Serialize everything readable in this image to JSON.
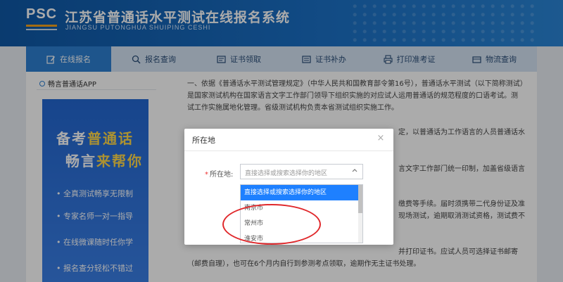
{
  "header": {
    "logo_text": "PSC",
    "title": "江苏省普通话水平测试在线报名系统",
    "subtitle": "JIANGSU PUTONGHUA SHUIPING CESHI"
  },
  "nav": {
    "items": [
      {
        "label": "在线报名",
        "icon": "edit-icon",
        "active": true
      },
      {
        "label": "报名查询",
        "icon": "search-icon",
        "active": false
      },
      {
        "label": "证书领取",
        "icon": "certificate-icon",
        "active": false
      },
      {
        "label": "证书补办",
        "icon": "certificate-reissue-icon",
        "active": false
      },
      {
        "label": "打印准考证",
        "icon": "printer-icon",
        "active": false
      },
      {
        "label": "物流查询",
        "icon": "truck-icon",
        "active": false
      }
    ]
  },
  "sidebar": {
    "title": "畅言普通话APP",
    "promo": {
      "line1_a": "备考",
      "line1_b": "普通话",
      "line2_a": "畅言",
      "line2_b": "来帮你",
      "items": [
        "全真测试畅享无限制",
        "专家名师一对一指导",
        "在线微课随时任你学",
        "报名查分轻松不错过"
      ]
    }
  },
  "article": {
    "p1": "一、依据《普通话水平测试管理规定》（中华人民共和国教育部令第16号），普通话水平测试（以下简称测试）是国家测试机构在国家语言文字工作部门领导下组织实施的对应试人运用普通话的规范程度的口语考试。测试工作实施属地化管理。省级测试机构负责本省测试组织实施工作。",
    "p2_tail": "定，以普通话为工作语言的人员普通话水",
    "p3_tail": "言文字工作部门统一印制，加盖省级语言",
    "p4_tail": "缴费等手续。届时须携带二代身份证及准",
    "p5_tail": "现场测试，逾期取消测试资格，测试费不",
    "p6_tail": "并打印证书。应试人员可选择证书邮寄",
    "p7": "（邮费自理），也可在6个月内自行到参测考点领取，逾期作无主证书处理。"
  },
  "modal": {
    "title": "所在地",
    "close": "×",
    "field_label": "所在地:",
    "required_mark": "*",
    "select_placeholder": "直接选择或搜索选择你的地区",
    "options": [
      "直接选择或搜索选择你的地区",
      "南京市",
      "常州市",
      "淮安市"
    ],
    "selected_index": 0
  },
  "colors": {
    "header_blue": "#1a6fc4",
    "nav_active": "#2d7fd1",
    "option_selected": "#1e80ff",
    "annotation_red": "#e0282b"
  }
}
